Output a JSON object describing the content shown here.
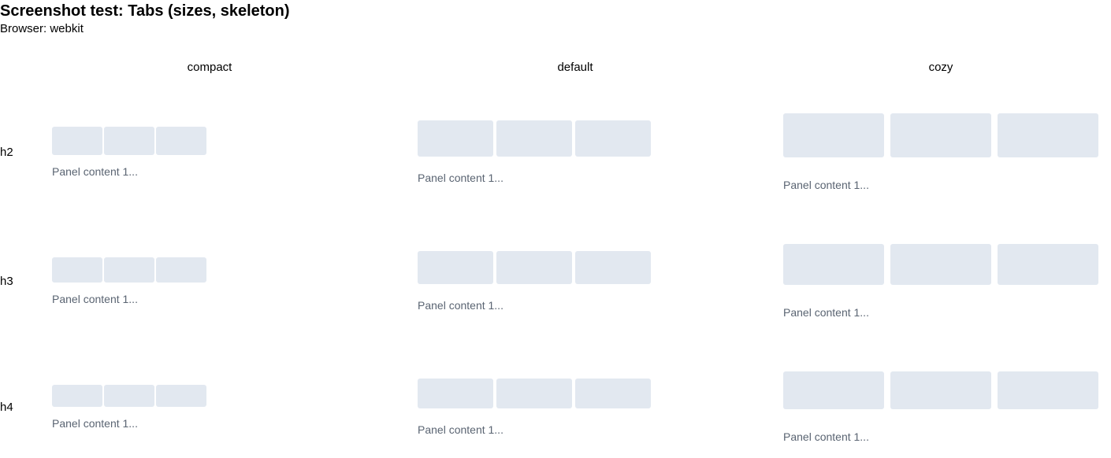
{
  "header": {
    "title": "Screenshot test: Tabs (sizes, skeleton)",
    "browser": "Browser: webkit"
  },
  "columns": [
    "compact",
    "default",
    "cozy"
  ],
  "rows": [
    "h2",
    "h3",
    "h4"
  ],
  "panel_text": "Panel content 1..."
}
